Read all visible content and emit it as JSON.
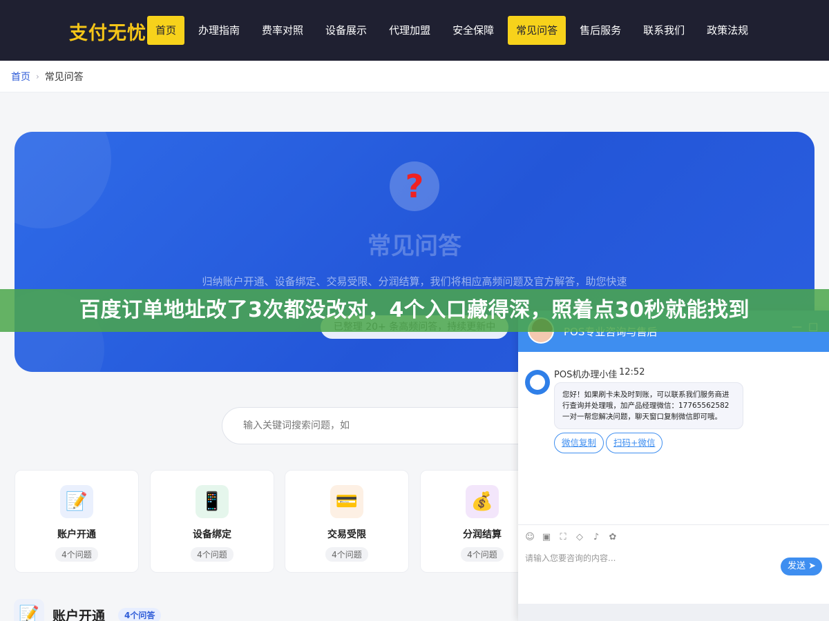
{
  "nav": {
    "logo": "支付无忧",
    "items": [
      {
        "label": "首页",
        "active": true
      },
      {
        "label": "办理指南",
        "active": false
      },
      {
        "label": "费率对照",
        "active": false
      },
      {
        "label": "设备展示",
        "active": false
      },
      {
        "label": "代理加盟",
        "active": false
      },
      {
        "label": "安全保障",
        "active": false
      },
      {
        "label": "常见问答",
        "active": true
      },
      {
        "label": "售后服务",
        "active": false
      },
      {
        "label": "联系我们",
        "active": false
      },
      {
        "label": "政策法规",
        "active": false
      }
    ],
    "active_color": "#f7d21b"
  },
  "breadcrumb": {
    "home": "首页",
    "current": "常见问答"
  },
  "hero": {
    "title": "常见问答",
    "desc": "归纳账户开通、设备绑定、交易受限、分润结算，我们将相应高频问题及官方解答，助您快速",
    "pill": "已整理 20+ 条高频问答，持续更新中"
  },
  "search": {
    "placeholder": "输入关键词搜索问题，如"
  },
  "categories": [
    {
      "name": "账户开通",
      "count": "4个问题",
      "icon": "memo-icon"
    },
    {
      "name": "设备绑定",
      "count": "4个问题",
      "icon": "phone-icon"
    },
    {
      "name": "交易受限",
      "count": "4个问题",
      "icon": "card-icon"
    },
    {
      "name": "分润结算",
      "count": "4个问题",
      "icon": "moneybag-icon"
    }
  ],
  "section": {
    "title": "账户开通",
    "badge": "4个问答"
  },
  "chat": {
    "title": "POS专业咨询与售后",
    "agent_name": "POS机办理小佳",
    "time": "12:52",
    "message": "您好！如果刷卡未及时到账，可以联系我们服务商进行查询并处理哦，加产品经理微信：17765562582 一对一帮您解决问题，聊天窗口复制微信即可哦。",
    "btn_copy": "微信复制",
    "btn_scan": "扫码+微信",
    "input_placeholder": "请输入您要咨询的内容...",
    "send": "发送",
    "min": "—",
    "max": "□"
  },
  "banner": {
    "text": "百度订单地址改了3次都没改对，4个入口藏得深，照着点30秒就能找到"
  }
}
